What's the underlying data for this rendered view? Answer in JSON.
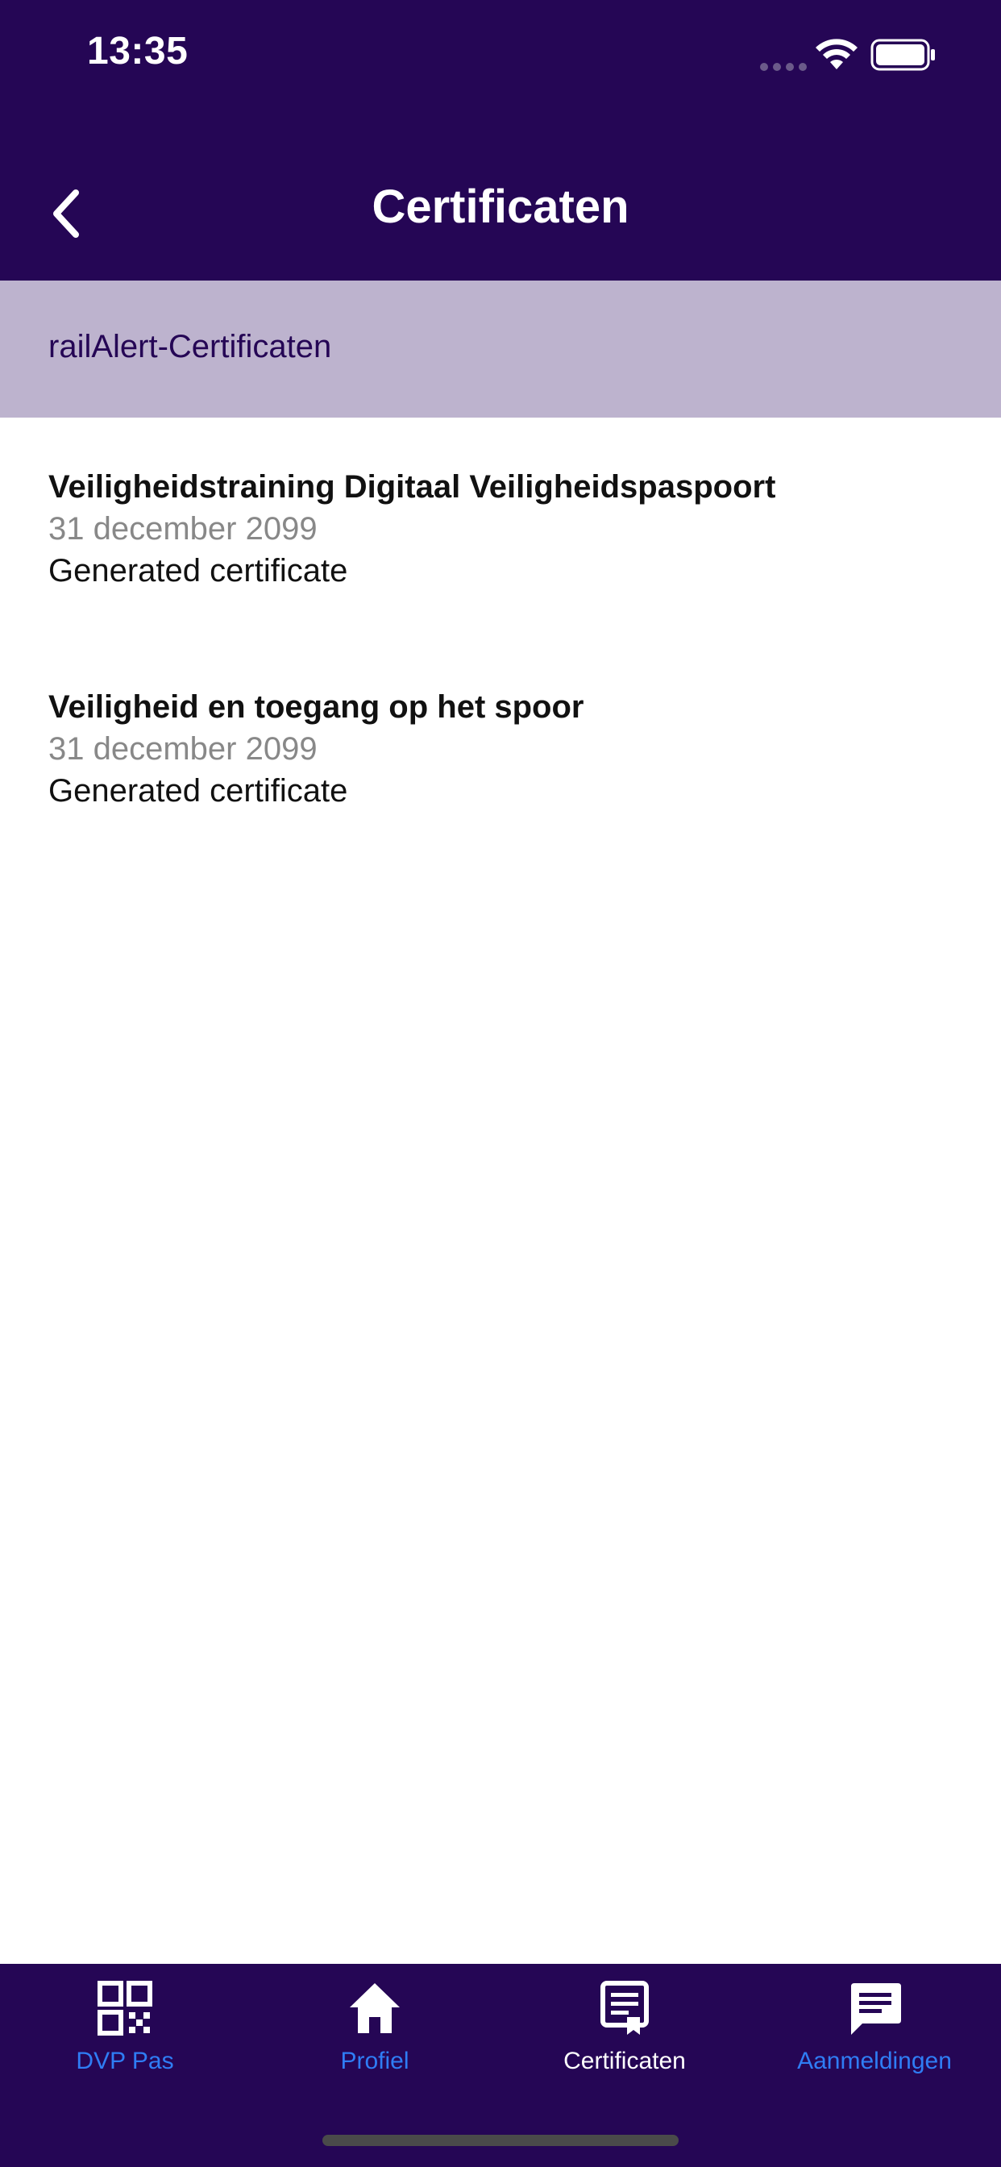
{
  "status_bar": {
    "time": "13:35"
  },
  "nav": {
    "title": "Certificaten",
    "back_icon": "chevron-left-icon"
  },
  "section": {
    "label": "railAlert-Certificaten"
  },
  "certificates": [
    {
      "title": "Veiligheidstraining Digitaal Veiligheidspaspoort",
      "date": "31 december 2099",
      "description": "Generated certificate"
    },
    {
      "title": "Veiligheid en toegang op het spoor",
      "date": "31 december 2099",
      "description": "Generated certificate"
    }
  ],
  "tabs": [
    {
      "label": "DVP Pas",
      "icon": "qr-code-icon",
      "active": false
    },
    {
      "label": "Profiel",
      "icon": "home-icon",
      "active": false
    },
    {
      "label": "Certificaten",
      "icon": "certificate-icon",
      "active": true
    },
    {
      "label": "Aanmeldingen",
      "icon": "message-icon",
      "active": false
    }
  ],
  "colors": {
    "primary": "#250655",
    "section_bg": "#bdb3ce",
    "tab_inactive": "#2f7df5",
    "tab_active": "#ffffff",
    "date_text": "#888888"
  }
}
